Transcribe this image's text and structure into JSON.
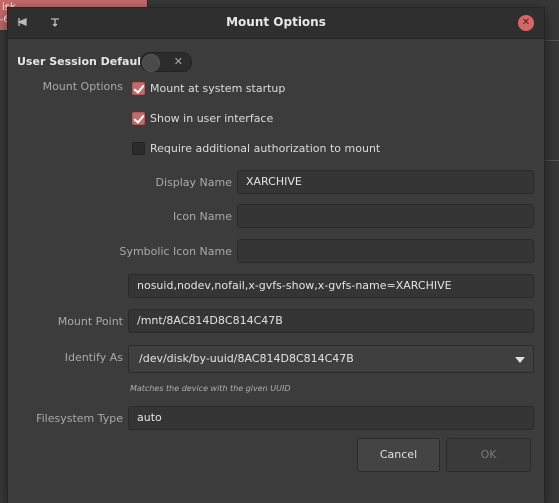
{
  "background": {
    "sidebar_line1": "isk",
    "sidebar_line2": "-68"
  },
  "dialog": {
    "title": "Mount Options",
    "pin_icon": "pin-icon",
    "minimize_icon": "arrow-icon",
    "close_icon": "close-icon"
  },
  "defaults": {
    "label": "User Session Defaults",
    "enabled": false,
    "toggle_symbol": "✕"
  },
  "mount_options": {
    "label": "Mount Options",
    "checkboxes": [
      {
        "label": "Mount at system startup",
        "checked": true
      },
      {
        "label": "Show in user interface",
        "checked": true
      },
      {
        "label": "Require additional authorization to mount",
        "checked": false
      }
    ]
  },
  "fields": {
    "display_name": {
      "label": "Display Name",
      "value": "XARCHIVE"
    },
    "icon_name": {
      "label": "Icon Name",
      "value": ""
    },
    "symbolic_icon_name": {
      "label": "Symbolic Icon Name",
      "value": ""
    },
    "options_string": {
      "value": "nosuid,nodev,nofail,x-gvfs-show,x-gvfs-name=XARCHIVE"
    },
    "mount_point": {
      "label": "Mount Point",
      "value": "/mnt/8AC814D8C814C47B"
    },
    "identify_as": {
      "label": "Identify As",
      "value": "/dev/disk/by-uuid/8AC814D8C814C47B",
      "hint": "Matches the device with the given UUID"
    },
    "filesystem_type": {
      "label": "Filesystem Type",
      "value": "auto"
    }
  },
  "buttons": {
    "cancel": "Cancel",
    "ok": "OK"
  },
  "colors": {
    "accent": "#c36a6a",
    "close": "#d96565"
  }
}
